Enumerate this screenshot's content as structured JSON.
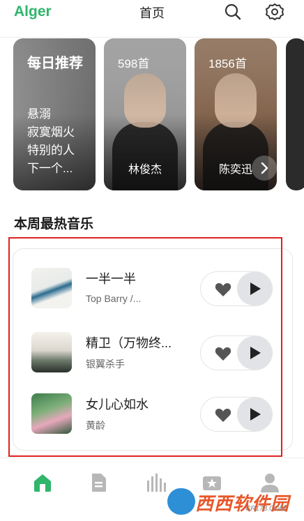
{
  "header": {
    "brand": "Alger",
    "title": "首页",
    "icons": [
      "search-icon",
      "gear-icon"
    ]
  },
  "featured": {
    "daily": {
      "title": "每日推荐",
      "songs": [
        "悬溺",
        "寂寞烟火",
        "特别的人",
        "下一个..."
      ]
    },
    "artists": [
      {
        "count": "598首",
        "name": "林俊杰"
      },
      {
        "count": "1856首",
        "name": "陈奕迅"
      }
    ]
  },
  "hot_section": {
    "title": "本周最热音乐",
    "songs": [
      {
        "title": "一半一半",
        "artist": "Top Barry /..."
      },
      {
        "title": "精卫（万物终...",
        "artist": "银翼杀手"
      },
      {
        "title": "女儿心如水",
        "artist": "黄龄"
      }
    ]
  },
  "bottom_nav": {
    "items": [
      "home-icon",
      "document-icon",
      "charts-icon",
      "favorites-icon",
      "user-icon"
    ],
    "active": "home-icon",
    "active_color": "#2fb56c",
    "inactive_color": "#b7b7b7"
  },
  "watermark": {
    "text": "西西软件园",
    "sub": "CR173.COM"
  },
  "colors": {
    "accent": "#2fb56c",
    "highlight_border": "#e02020"
  }
}
